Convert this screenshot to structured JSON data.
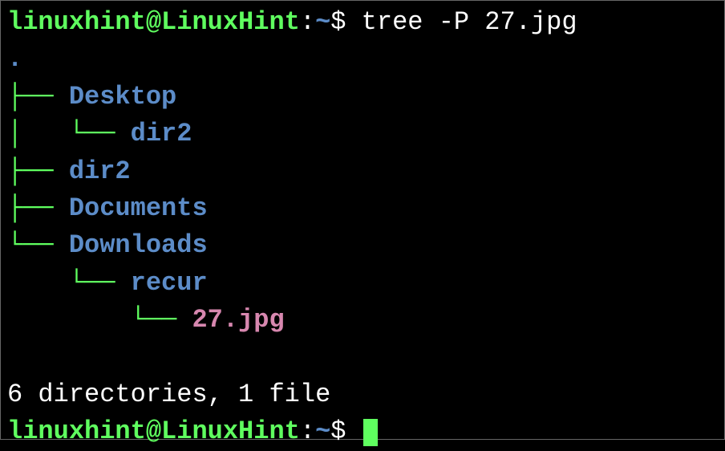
{
  "prompt": {
    "user": "linuxhint",
    "at": "@",
    "host": "LinuxHint",
    "colon": ":",
    "path": "~",
    "dollar": "$"
  },
  "command": "tree -P 27.jpg",
  "tree": {
    "root": ".",
    "branches": {
      "tee": "├── ",
      "ell": "└── ",
      "pipe": "│   ",
      "space": "    "
    },
    "entries": {
      "desktop": "Desktop",
      "dir2a": "dir2",
      "dir2b": "dir2",
      "documents": "Documents",
      "downloads": "Downloads",
      "recur": "recur",
      "file1": "27.jpg"
    }
  },
  "summary": "6 directories, 1 file"
}
